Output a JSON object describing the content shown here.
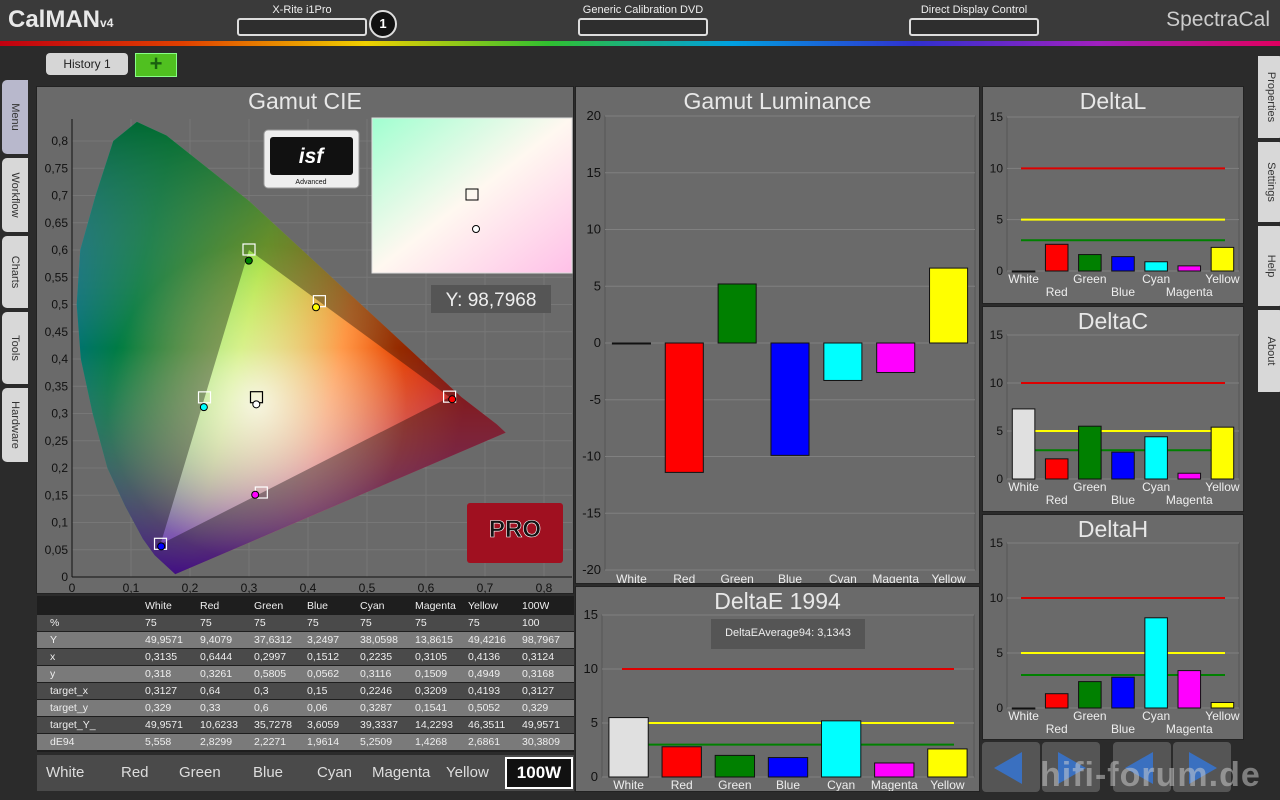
{
  "app": {
    "logo": "CalMAN",
    "logo_version": "v4",
    "brand": "SpectraCal"
  },
  "devices": [
    {
      "label": "X-Rite i1Pro",
      "badge": "1"
    },
    {
      "label": "Generic Calibration DVD"
    },
    {
      "label": "Direct Display Control"
    }
  ],
  "history_tab": "History 1",
  "add_button": "+",
  "left_tabs": [
    "Menu",
    "Workflow",
    "Charts",
    "Tools",
    "Hardware"
  ],
  "right_tabs": [
    "Properties",
    "Settings",
    "Help",
    "About"
  ],
  "colors": {
    "White": "#e0e0e0",
    "Red": "#ff0000",
    "Green": "#008000",
    "Blue": "#0000ff",
    "Cyan": "#00ffff",
    "Magenta": "#ff00ff",
    "Yellow": "#ffff00",
    "ref_red": "#dd0000",
    "ref_yellow": "#ffff00",
    "ref_green": "#008000"
  },
  "gamut_cie": {
    "title": "Gamut CIE",
    "y_readout": "Y: 98,7968",
    "logo_isf": "isf",
    "logo_isf_sub": "Advanced",
    "logo_pro": "PRO",
    "x_ticks": [
      "0",
      "0,1",
      "0,2",
      "0,3",
      "0,4",
      "0,5",
      "0,6",
      "0,7",
      "0,8"
    ],
    "y_ticks": [
      "0",
      "0,05",
      "0,1",
      "0,15",
      "0,2",
      "0,25",
      "0,3",
      "0,35",
      "0,4",
      "0,45",
      "0,5",
      "0,55",
      "0,6",
      "0,65",
      "0,7",
      "0,75",
      "0,8"
    ],
    "targets": [
      {
        "name": "Red",
        "x": 0.64,
        "y": 0.33
      },
      {
        "name": "Green",
        "x": 0.3,
        "y": 0.6
      },
      {
        "name": "Blue",
        "x": 0.15,
        "y": 0.06
      },
      {
        "name": "Cyan",
        "x": 0.2246,
        "y": 0.3287
      },
      {
        "name": "Magenta",
        "x": 0.3209,
        "y": 0.1541
      },
      {
        "name": "Yellow",
        "x": 0.4193,
        "y": 0.5052
      },
      {
        "name": "White",
        "x": 0.3127,
        "y": 0.329
      }
    ],
    "measured": [
      {
        "name": "Red",
        "x": 0.6444,
        "y": 0.3261
      },
      {
        "name": "Green",
        "x": 0.2997,
        "y": 0.5805
      },
      {
        "name": "Blue",
        "x": 0.1512,
        "y": 0.0562
      },
      {
        "name": "Cyan",
        "x": 0.2235,
        "y": 0.3116
      },
      {
        "name": "Magenta",
        "x": 0.3105,
        "y": 0.1509
      },
      {
        "name": "Yellow",
        "x": 0.4136,
        "y": 0.4949
      },
      {
        "name": "White",
        "x": 0.3124,
        "y": 0.3168
      }
    ]
  },
  "table": {
    "columns": [
      "",
      "White",
      "Red",
      "Green",
      "Blue",
      "Cyan",
      "Magenta",
      "Yellow",
      "100W"
    ],
    "rows": [
      [
        "%",
        "75",
        "75",
        "75",
        "75",
        "75",
        "75",
        "75",
        "100"
      ],
      [
        "Y",
        "49,9571",
        "9,4079",
        "37,6312",
        "3,2497",
        "38,0598",
        "13,8615",
        "49,4216",
        "98,7967"
      ],
      [
        "x",
        "0,3135",
        "0,6444",
        "0,2997",
        "0,1512",
        "0,2235",
        "0,3105",
        "0,4136",
        "0,3124"
      ],
      [
        "y",
        "0,318",
        "0,3261",
        "0,5805",
        "0,0562",
        "0,3116",
        "0,1509",
        "0,4949",
        "0,3168"
      ],
      [
        "target_x",
        "0,3127",
        "0,64",
        "0,3",
        "0,15",
        "0,2246",
        "0,3209",
        "0,4193",
        "0,3127"
      ],
      [
        "target_y",
        "0,329",
        "0,33",
        "0,6",
        "0,06",
        "0,3287",
        "0,1541",
        "0,5052",
        "0,329"
      ],
      [
        "target_Y_",
        "49,9571",
        "10,6233",
        "35,7278",
        "3,6059",
        "39,3337",
        "14,2293",
        "46,3511",
        "49,9571"
      ],
      [
        "dE94",
        "5,558",
        "2,8299",
        "2,2271",
        "1,9614",
        "5,2509",
        "1,4268",
        "2,6861",
        "30,3809"
      ]
    ]
  },
  "selector": {
    "items": [
      "White",
      "Red",
      "Green",
      "Blue",
      "Cyan",
      "Magenta",
      "Yellow"
    ],
    "selected": "100W"
  },
  "watermark": "hifi-forum.de",
  "chart_data": [
    {
      "type": "bar",
      "title": "Gamut Luminance",
      "categories": [
        "White",
        "Red",
        "Green",
        "Blue",
        "Cyan",
        "Magenta",
        "Yellow"
      ],
      "values": [
        0,
        -11.4,
        5.2,
        -9.9,
        -3.3,
        -2.6,
        6.6
      ],
      "ylim": [
        -20,
        20
      ],
      "y_ticks": [
        "20",
        "15",
        "10",
        "5",
        "0",
        "-5",
        "-10",
        "-15",
        "-20"
      ]
    },
    {
      "type": "bar",
      "title": "DeltaE 1994",
      "annotation": "DeltaEAverage94: 3,1343",
      "categories": [
        "White",
        "Red",
        "Green",
        "Blue",
        "Cyan",
        "Magenta",
        "Yellow"
      ],
      "values": [
        5.5,
        2.8,
        2.0,
        1.8,
        5.2,
        1.3,
        2.6
      ],
      "ylim": [
        0,
        15
      ],
      "y_ticks": [
        "15",
        "10",
        "5",
        "0"
      ],
      "ref_lines": [
        10,
        5,
        3
      ]
    },
    {
      "type": "bar",
      "title": "DeltaL",
      "categories": [
        "White",
        "Red",
        "Green",
        "Blue",
        "Cyan",
        "Magenta",
        "Yellow"
      ],
      "values": [
        0,
        2.6,
        1.6,
        1.4,
        0.9,
        0.5,
        2.3
      ],
      "ylim": [
        0,
        15
      ],
      "y_ticks": [
        "15",
        "10",
        "5",
        "0"
      ],
      "ref_lines": [
        10,
        5,
        3
      ]
    },
    {
      "type": "bar",
      "title": "DeltaC",
      "categories": [
        "White",
        "Red",
        "Green",
        "Blue",
        "Cyan",
        "Magenta",
        "Yellow"
      ],
      "values": [
        7.3,
        2.1,
        5.5,
        2.8,
        4.4,
        0.6,
        5.4
      ],
      "ylim": [
        0,
        15
      ],
      "y_ticks": [
        "15",
        "10",
        "5",
        "0"
      ],
      "ref_lines": [
        10,
        5,
        3
      ]
    },
    {
      "type": "bar",
      "title": "DeltaH",
      "categories": [
        "White",
        "Red",
        "Green",
        "Blue",
        "Cyan",
        "Magenta",
        "Yellow"
      ],
      "values": [
        0,
        1.3,
        2.4,
        2.8,
        8.2,
        3.4,
        0.5
      ],
      "ylim": [
        0,
        15
      ],
      "y_ticks": [
        "15",
        "10",
        "5",
        "0"
      ],
      "ref_lines": [
        10,
        5,
        3
      ]
    }
  ]
}
